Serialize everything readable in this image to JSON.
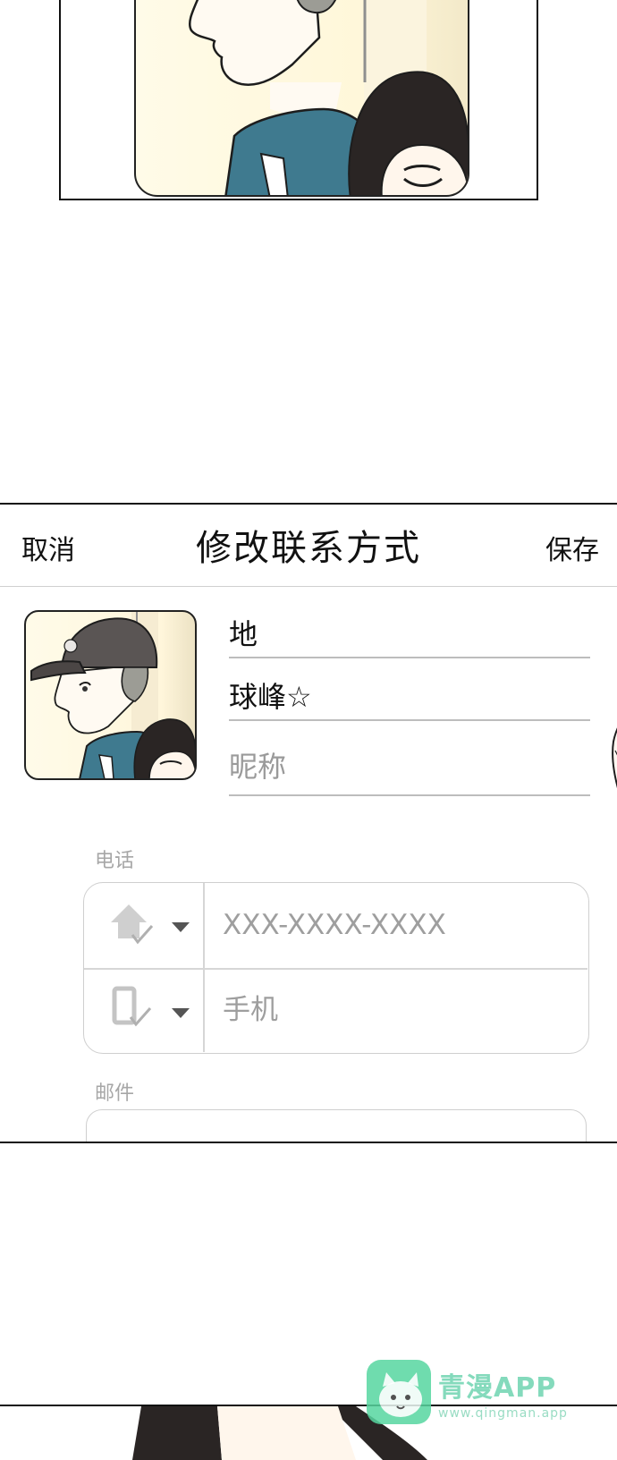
{
  "nav": {
    "cancel": "取消",
    "title": "修改联系方式",
    "save": "保存"
  },
  "contact": {
    "last_name": "地",
    "first_name": "球峰☆",
    "nickname_placeholder": "昵称"
  },
  "phone_section": {
    "label": "电话",
    "rows": [
      {
        "type_icon": "home-phone-icon",
        "placeholder": "XXX-XXXX-XXXX"
      },
      {
        "type_icon": "mobile-phone-icon",
        "placeholder": "手机"
      }
    ]
  },
  "mail_section": {
    "label": "邮件"
  },
  "watermark": {
    "title": "青漫APP",
    "url": "www.qingman.app",
    "logo_icon": "cat-logo-icon"
  },
  "colors": {
    "watermark_green": "#57d6a0",
    "shirt_blue": "#3f7a8f",
    "cap_gray": "#5a5554"
  }
}
